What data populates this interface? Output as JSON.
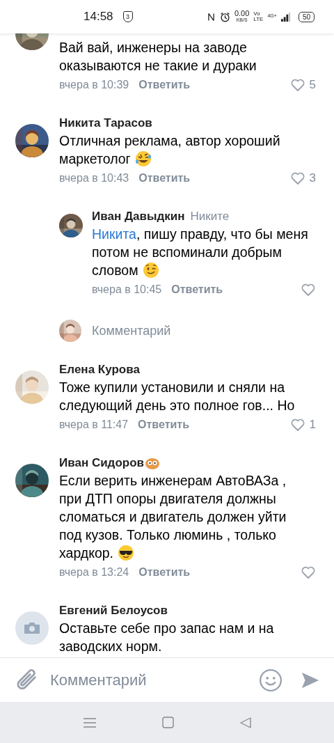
{
  "status_bar": {
    "time": "14:58",
    "shield_number": "3",
    "speed": "0.00",
    "speed_unit": "KB/S",
    "volte_top": "Vo",
    "volte_bottom": "LTE",
    "network": "4G+",
    "battery": "50"
  },
  "comments": [
    {
      "text": "Вай вай, инженеры на заводе оказываются не такие и дураки",
      "time": "вчера в 10:39",
      "reply": "Ответить",
      "likes": "5"
    },
    {
      "name": "Никита Тарасов",
      "text": "Отличная реклама, автор хороший маркетолог",
      "emoji": {
        "kind": "rofl"
      },
      "time": "вчера в 10:43",
      "reply": "Ответить",
      "likes": "3"
    },
    {
      "kind": "reply",
      "name": "Иван Давыдкин",
      "reply_to": "Никите",
      "mention": "Никита",
      "text": ", пишу правду, что бы меня потом не вспоминали добрым словом",
      "emoji": {
        "kind": "wink"
      },
      "time": "вчера в 10:45",
      "reply": "Ответить"
    },
    {
      "kind": "reply_field",
      "placeholder": "Комментарий"
    },
    {
      "name": "Елена Курова",
      "text": "Тоже купили установили и сняли на следующий день это полное гов... Но",
      "time": "вчера в 11:47",
      "reply": "Ответить",
      "likes": "1"
    },
    {
      "name": "Иван Сидоров",
      "badge": true,
      "text": "Если верить инженерам АвтоВАЗа , при ДТП опоры двигателя должны сломаться и двигатель должен уйти под кузов. Только люминь , только хардкор.",
      "emoji": {
        "kind": "cool"
      },
      "time": "вчера в 13:24",
      "reply": "Ответить"
    },
    {
      "avatar": {
        "kind": "placeholder"
      },
      "name": "Евгений Белоусов",
      "text": "Оставьте себе про запас нам и на заводских норм."
    }
  ],
  "composer": {
    "placeholder": "Комментарий"
  }
}
